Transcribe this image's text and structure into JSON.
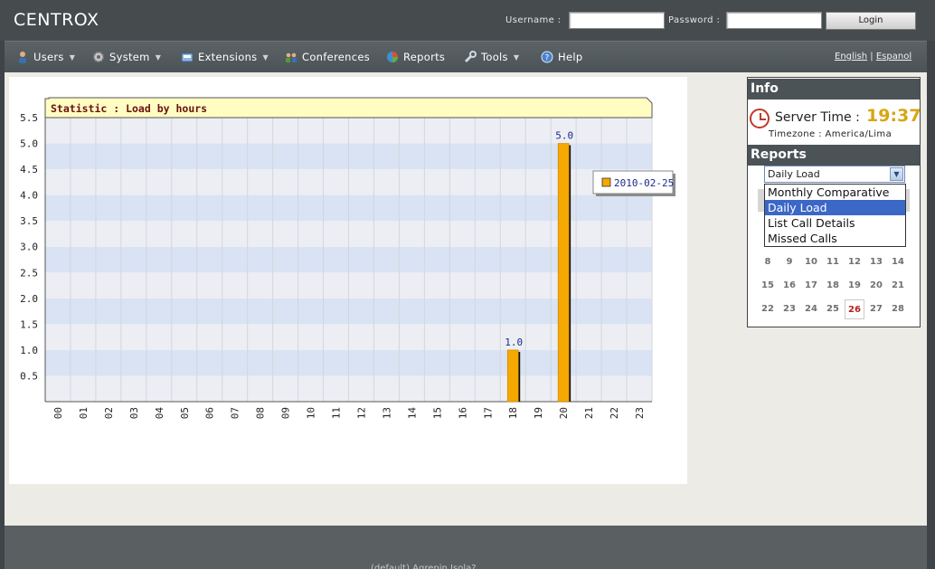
{
  "app": {
    "title": "CENTROX"
  },
  "login": {
    "username_label": "Username :",
    "password_label": "Password :",
    "username_value": "",
    "password_value": "",
    "login_button": "Login"
  },
  "menu": [
    {
      "label": "Users",
      "icon": "users-icon",
      "has_caret": true
    },
    {
      "label": "System",
      "icon": "gear-icon",
      "has_caret": true
    },
    {
      "label": "Extensions",
      "icon": "phone-icon",
      "has_caret": true
    },
    {
      "label": "Conferences",
      "icon": "conference-icon",
      "has_caret": false
    },
    {
      "label": "Reports",
      "icon": "pie-chart-icon",
      "has_caret": false
    },
    {
      "label": "Tools",
      "icon": "wrench-icon",
      "has_caret": true
    },
    {
      "label": "Help",
      "icon": "help-icon",
      "has_caret": false
    }
  ],
  "languages": {
    "english": "English",
    "separator": "|",
    "espanol": "Espanol"
  },
  "chart_data": {
    "type": "bar",
    "title": "Statistic : Load by hours",
    "categories": [
      "00",
      "01",
      "02",
      "03",
      "04",
      "05",
      "06",
      "07",
      "08",
      "09",
      "10",
      "11",
      "12",
      "13",
      "14",
      "15",
      "16",
      "17",
      "18",
      "19",
      "20",
      "21",
      "22",
      "23"
    ],
    "series": [
      {
        "name": "2010-02-25",
        "values": [
          0,
          0,
          0,
          0,
          0,
          0,
          0,
          0,
          0,
          0,
          0,
          0,
          0,
          0,
          0,
          0,
          0,
          0,
          1.0,
          0,
          5.0,
          0,
          0,
          0
        ],
        "color": "#f5a800"
      }
    ],
    "data_labels": {
      "18": "1.0",
      "20": "5.0"
    },
    "ylim": [
      0,
      5.5
    ],
    "yticks": [
      "0.5",
      "1.0",
      "1.5",
      "2.0",
      "2.5",
      "3.0",
      "3.5",
      "4.0",
      "4.5",
      "5.0",
      "5.5"
    ],
    "xlabel": "",
    "ylabel": "",
    "grid": true,
    "legend": "top-right",
    "colors": {
      "band_light": "#eceef3",
      "band_blue": "#d9e3f4",
      "title_bg": "#fffdc2",
      "title_text": "#6b1010"
    }
  },
  "sidebar": {
    "info_heading": "Info",
    "server_time_label": "Server Time :",
    "server_time": "19:37",
    "timezone": "Timezone : America/Lima",
    "reports_heading": "Reports",
    "report_select_value": "Daily Load",
    "report_options": [
      "Monthly Comparative",
      "Daily Load",
      "List Call Details",
      "Missed Calls"
    ],
    "report_selected_index": 1,
    "calendar_days": [
      [
        "8",
        "9",
        "10",
        "11",
        "12",
        "13",
        "14"
      ],
      [
        "15",
        "16",
        "17",
        "18",
        "19",
        "20",
        "21"
      ],
      [
        "22",
        "23",
        "24",
        "25",
        "26",
        "27",
        "28"
      ]
    ],
    "calendar_today": "26"
  },
  "footer": {
    "text": "(default) Agrepin Isola? ..."
  }
}
